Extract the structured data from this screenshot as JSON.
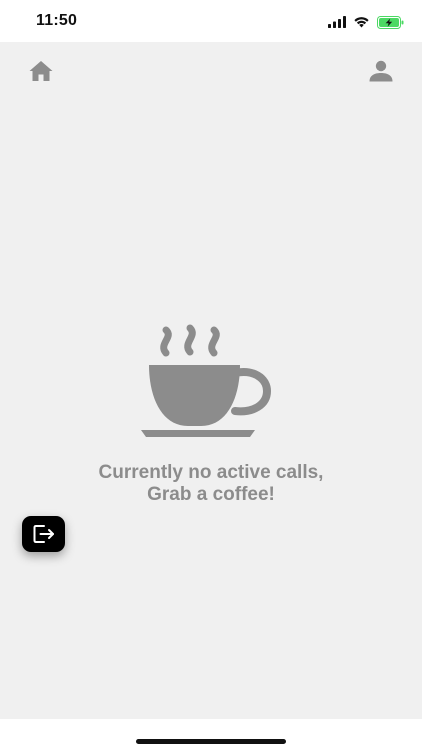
{
  "status_bar": {
    "time": "11:50",
    "icons": [
      "cellular-signal-icon",
      "wifi-icon",
      "battery-charging-icon"
    ],
    "battery_color": "#4cd964"
  },
  "top_bar": {
    "left_icon": "home-icon",
    "right_icon": "person-icon",
    "icon_color": "#8c8c8c"
  },
  "empty_state": {
    "icon": "coffee-cup-icon",
    "line1": "Currently no active calls,",
    "line2": "Grab a coffee!",
    "text_color": "#8c8c8c"
  },
  "fab": {
    "icon": "logout-icon",
    "background": "#000000"
  },
  "colors": {
    "app_background": "#f0f0f0"
  }
}
